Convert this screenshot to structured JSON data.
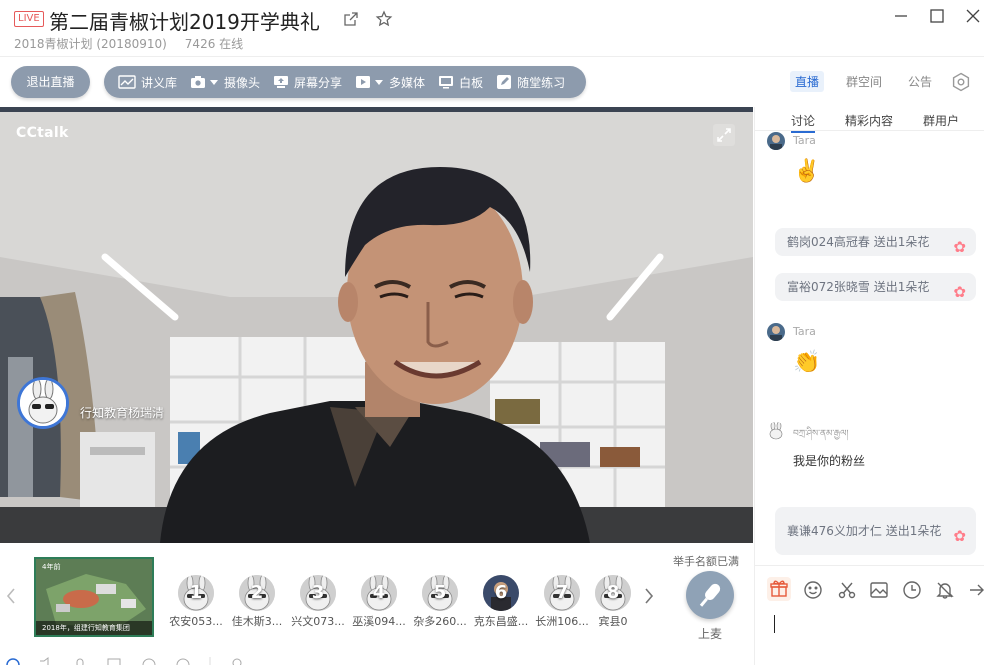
{
  "window": {
    "live_badge": "LIVE",
    "title": "第二届青椒计划2019开学典礼",
    "subtitle_group": "2018青椒计划 (20180910)",
    "online_count": "7426 在线"
  },
  "toolbar": {
    "exit_label": "退出直播",
    "tools": [
      {
        "label": "讲义库",
        "icon": "chart-icon"
      },
      {
        "label": "摄像头",
        "icon": "camera-icon"
      },
      {
        "label": "屏幕分享",
        "icon": "screen-share-icon"
      },
      {
        "label": "多媒体",
        "icon": "play-icon"
      },
      {
        "label": "白板",
        "icon": "whiteboard-icon"
      },
      {
        "label": "随堂练习",
        "icon": "edit-icon"
      }
    ]
  },
  "right_tabs": {
    "live": "直播",
    "group_space": "群空间",
    "notice": "公告"
  },
  "video": {
    "brand": "CCtalk",
    "speaker_name": "行知教育杨瑞清"
  },
  "strip": {
    "thumb_top": "4年前",
    "thumb_caption": "2018年，组建行知教育集团",
    "raise_hand_label": "举手名额已满",
    "mic_label": "上麦",
    "members": [
      {
        "num": "1",
        "name": "农安053..."
      },
      {
        "num": "2",
        "name": "佳木斯3..."
      },
      {
        "num": "3",
        "name": "兴文073..."
      },
      {
        "num": "4",
        "name": "巫溪094..."
      },
      {
        "num": "5",
        "name": "杂多260..."
      },
      {
        "num": "6",
        "name": "克东昌盛..."
      },
      {
        "num": "7",
        "name": "长洲106..."
      },
      {
        "num": "8",
        "name": "宾县0"
      }
    ]
  },
  "chat": {
    "subtabs": {
      "discussion": "讨论",
      "highlights": "精彩内容",
      "members": "群用户"
    },
    "msg1_user": "Tara",
    "msg1_emoji": "✌️",
    "flower1": "鹤岗024高冠春 送出1朵花",
    "flower2": "富裕072张晓雪 送出1朵花",
    "msg2_user": "Tara",
    "msg2_emoji": "👏",
    "msg3_user": "བཀྲ་ཤིས་ནམ་རྒྱལ།",
    "msg3_text": "我是你的粉丝",
    "flower3": "襄谦476义加才仁 送出1朵花"
  },
  "colors": {
    "accent": "#2a6bd2",
    "pill": "#8d9bad",
    "live_red": "#e65a5a"
  }
}
